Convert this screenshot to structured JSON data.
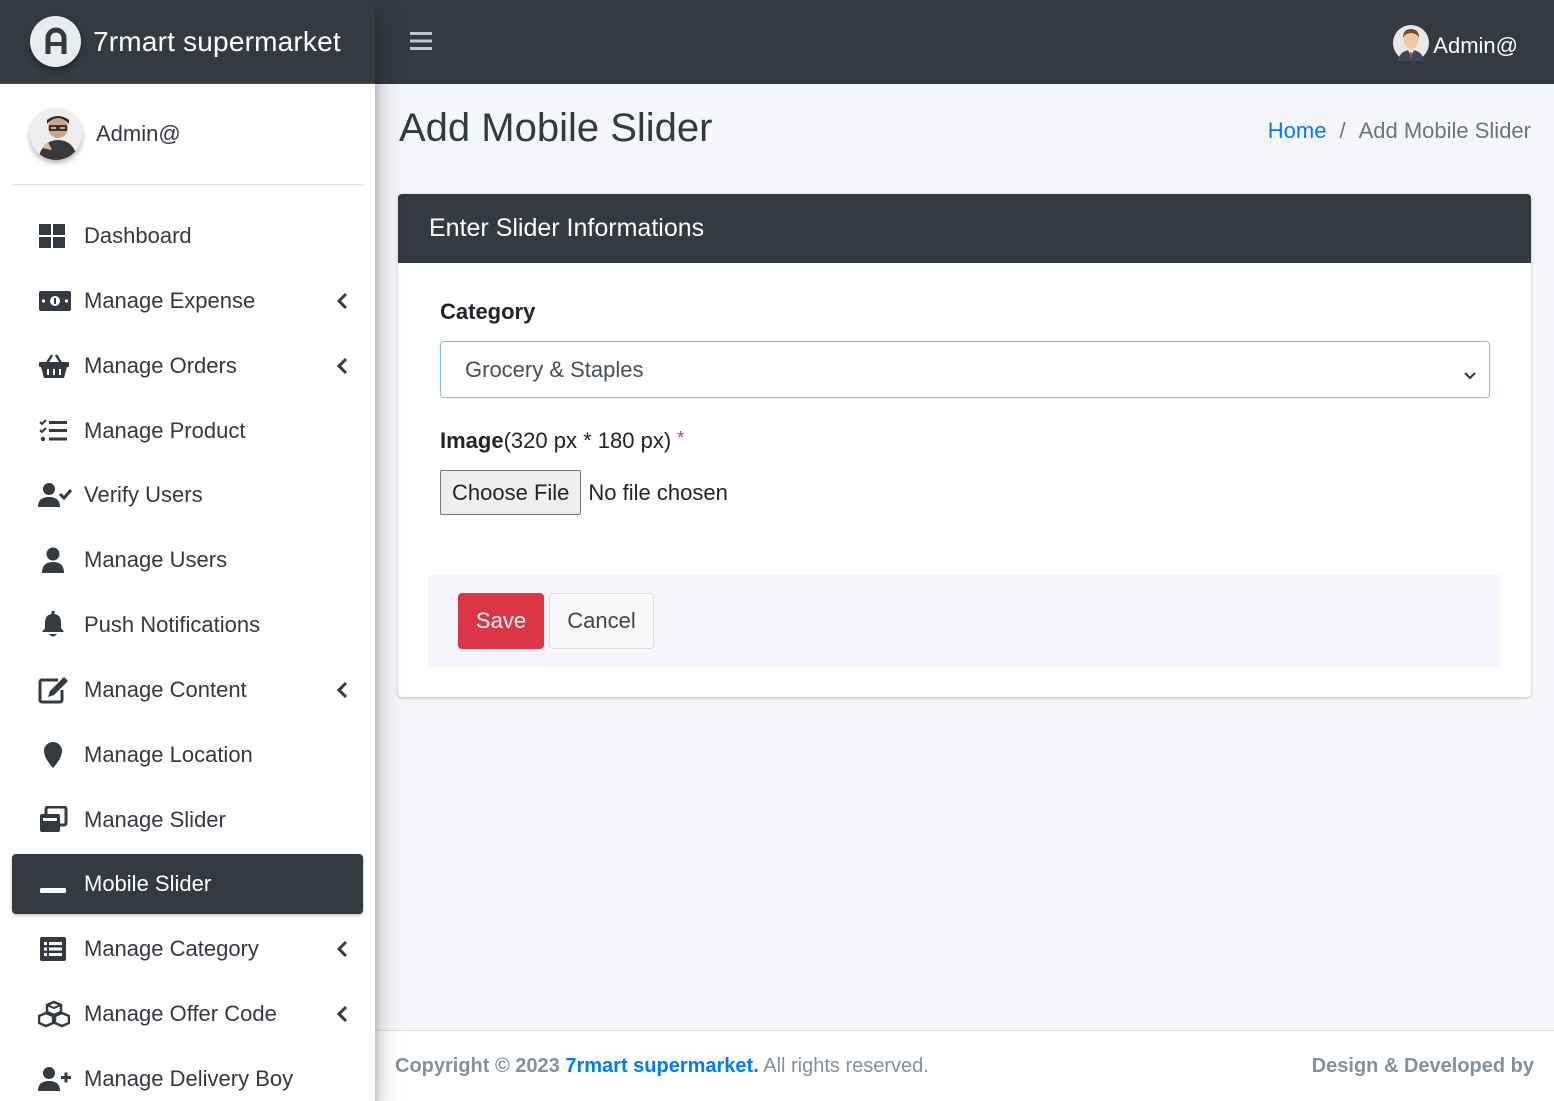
{
  "brand": {
    "name": "7rmart supermarket",
    "logo_icon": "a-letter-logo-icon"
  },
  "sidebar_user": {
    "name": "Admin@"
  },
  "top_user": {
    "name": "Admin@"
  },
  "nav": {
    "items": [
      {
        "label": "Dashboard",
        "icon": "dashboard-icon",
        "has_arrow": false,
        "active": false
      },
      {
        "label": "Manage Expense",
        "icon": "money-bill-icon",
        "has_arrow": true,
        "active": false
      },
      {
        "label": "Manage Orders",
        "icon": "basket-icon",
        "has_arrow": true,
        "active": false
      },
      {
        "label": "Manage Product",
        "icon": "task-list-icon",
        "has_arrow": false,
        "active": false
      },
      {
        "label": "Verify Users",
        "icon": "user-check-icon",
        "has_arrow": false,
        "active": false
      },
      {
        "label": "Manage Users",
        "icon": "user-icon",
        "has_arrow": false,
        "active": false
      },
      {
        "label": "Push Notifications",
        "icon": "bell-icon",
        "has_arrow": false,
        "active": false
      },
      {
        "label": "Manage Content",
        "icon": "edit-icon",
        "has_arrow": true,
        "active": false
      },
      {
        "label": "Manage Location",
        "icon": "map-marker-icon",
        "has_arrow": false,
        "active": false
      },
      {
        "label": "Manage Slider",
        "icon": "window-restore-icon",
        "has_arrow": false,
        "active": false
      },
      {
        "label": "Mobile Slider",
        "icon": "minus-icon",
        "has_arrow": false,
        "active": true
      },
      {
        "label": "Manage Category",
        "icon": "list-alt-icon",
        "has_arrow": true,
        "active": false
      },
      {
        "label": "Manage Offer Code",
        "icon": "cubes-icon",
        "has_arrow": true,
        "active": false
      },
      {
        "label": "Manage Delivery Boy",
        "icon": "user-plus-icon",
        "has_arrow": false,
        "active": false
      }
    ]
  },
  "page": {
    "title": "Add Mobile Slider",
    "breadcrumb": {
      "home": "Home",
      "separator": "/",
      "current": "Add Mobile Slider"
    }
  },
  "form": {
    "header": "Enter Slider Informations",
    "category_label": "Category",
    "category_value": "Grocery & Staples",
    "image_label_bold": "Image",
    "image_label_hint": "(320 px * 180 px)",
    "required_mark": "*",
    "choose_file_label": "Choose File",
    "file_status": "No file chosen",
    "save_label": "Save",
    "cancel_label": "Cancel"
  },
  "footer": {
    "copyright_prefix": "Copyright © 2023 ",
    "copyright_brand": "7rmart supermarket.",
    "copyright_suffix": " All rights reserved.",
    "credit": "Design & Developed by"
  },
  "colors": {
    "dark": "#343a40",
    "accent": "#007bff",
    "danger": "#dc3545"
  }
}
